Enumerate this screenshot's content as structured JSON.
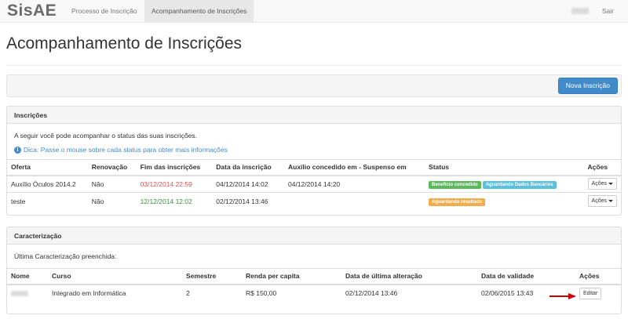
{
  "navbar": {
    "brand": "SisAE",
    "items": [
      {
        "label": "Processo de Inscrição",
        "active": false
      },
      {
        "label": "Acompanhamento de Inscrições",
        "active": true
      }
    ],
    "logout_label": "Sair"
  },
  "page": {
    "title": "Acompanhamento de Inscrições",
    "new_button_label": "Nova Inscrição"
  },
  "inscricoes": {
    "heading": "Inscrições",
    "intro": "A seguir você pode acompanhar o status das suas inscrições.",
    "tip": "Dica: Passe o mouse sobre cada status para obter mais informações",
    "columns": [
      "Oferta",
      "Renovação",
      "Fim das inscrições",
      "Data da inscrição",
      "Auxilio concedido em - Suspenso em",
      "Status",
      "Ações"
    ],
    "rows": [
      {
        "oferta": "Auxílio Óculos 2014.2",
        "renovacao": "Não",
        "fim": "03/12/2014 22:59",
        "data": "04/12/2014 14:02",
        "auxilio": "04/12/2014 14:20",
        "status": [
          "Benefício concedido",
          "Aguardando Dados Bancários"
        ],
        "acoes": "Ações"
      },
      {
        "oferta": "teste",
        "renovacao": "Não",
        "fim": "12/12/2014 12:02",
        "data": "02/12/2014 13:46",
        "auxilio": "",
        "status": [
          "Aguardando resultado"
        ],
        "acoes": "Ações"
      }
    ]
  },
  "caracterizacao": {
    "heading": "Caracterização",
    "intro": "Última Caracterização preenchida:",
    "columns": [
      "Nome",
      "Curso",
      "Semestre",
      "Renda per capita",
      "Data de última alteração",
      "Data de validade",
      "Ações"
    ],
    "rows": [
      {
        "curso": "Integrado em Informática",
        "semestre": "2",
        "renda": "R$ 150,00",
        "alteracao": "02/12/2014 13:46",
        "validade": "02/06/2015 13:43",
        "editar": "Editar"
      }
    ]
  },
  "colors": {
    "primary": "#428bca",
    "success": "#5cb85c",
    "info": "#5bc0de",
    "warning": "#f0ad4e",
    "danger": "#d9534f",
    "arrow": "#cc0000"
  },
  "icons": {
    "tip": "info-circle-icon",
    "dropdown": "caret-down-icon",
    "annotation": "red-arrow-icon"
  }
}
